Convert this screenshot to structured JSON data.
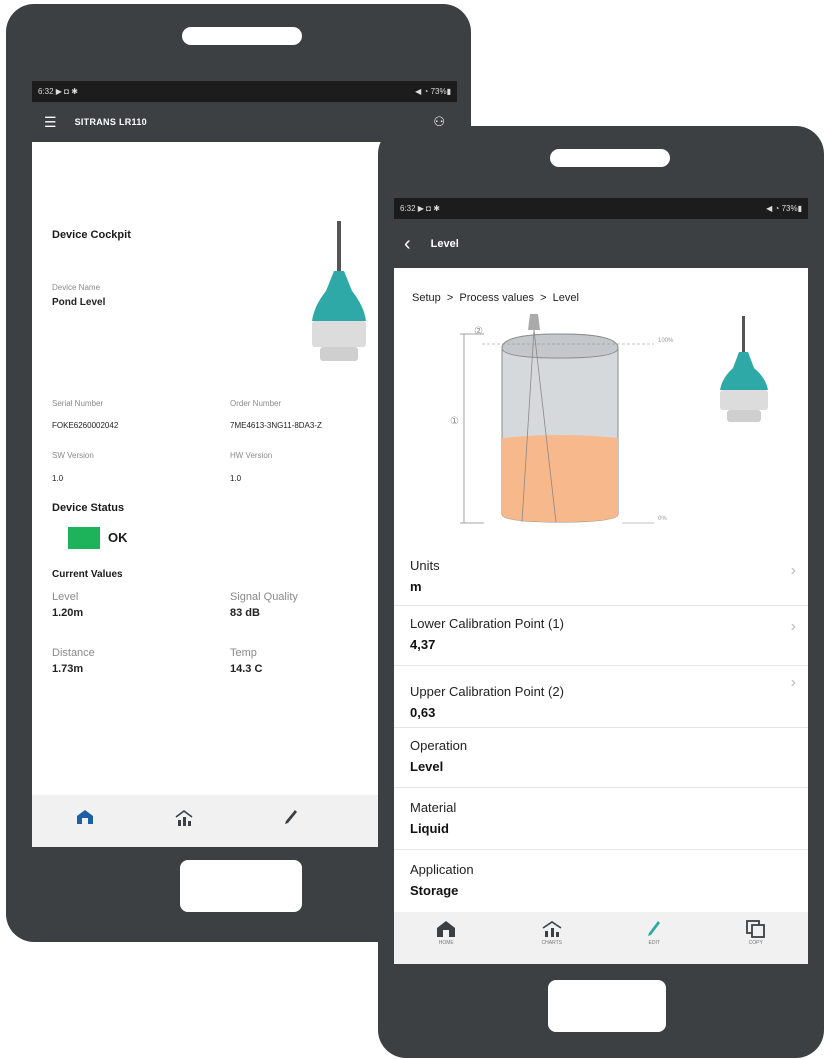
{
  "back_phone": {
    "status_bar": {
      "time": "6:32 ▶ ◘ ✱",
      "right": "◀ ◔ 73%▮"
    },
    "app_bar": {
      "title": "SITRANS LR110"
    },
    "cockpit": {
      "title": "Device Cockpit",
      "device_name_label": "Device Name",
      "device_name": "Pond Level",
      "serial_label": "Serial Number",
      "serial": "FOKE6260002042",
      "order_label": "Order Number",
      "order": "7ME4613-3NG11-8DA3-Z",
      "sw_label": "SW Version",
      "sw": "1.0",
      "hw_label": "HW Version",
      "hw": "1.0",
      "status_title": "Device Status",
      "status_text": "OK",
      "status_color": "#1db35a",
      "current_title": "Current Values",
      "level_label": "Level",
      "level": "1.20m",
      "signal_label": "Signal Quality",
      "signal": "83 dB",
      "distance_label": "Distance",
      "distance": "1.73m",
      "temp_label": "Temp",
      "temp": "14.3 C"
    },
    "nav": {
      "icons": [
        "home-icon",
        "charts-icon",
        "edit-icon"
      ]
    }
  },
  "front_phone": {
    "status_bar": {
      "time": "6:32 ▶ ◘ ✱",
      "right": "◀ ◔ 73%▮"
    },
    "app_bar": {
      "title": "Level"
    },
    "breadcrumb": "Setup  >  Process values  >  Level",
    "diagram": {
      "label_2": "②",
      "label_1": "①",
      "pct_100": "100%",
      "pct_0": "0%"
    },
    "rows": [
      {
        "label": "Units",
        "value": "m",
        "chevron": true
      },
      {
        "label": "Lower Calibration Point (1)",
        "value": "4,37",
        "chevron": true
      },
      {
        "label": "Upper Calibration Point (2)",
        "value": "0,63",
        "chevron": true
      },
      {
        "label": "Operation",
        "value": "Level",
        "chevron": false
      },
      {
        "label": "Material",
        "value": "Liquid",
        "chevron": false
      },
      {
        "label": "Application",
        "value": "Storage",
        "chevron": false
      }
    ],
    "nav": [
      {
        "label": "HOME",
        "icon": "home-icon"
      },
      {
        "label": "CHARTS",
        "icon": "charts-icon"
      },
      {
        "label": "EDIT",
        "icon": "edit-icon"
      },
      {
        "label": "COPY",
        "icon": "copy-icon"
      }
    ]
  },
  "colors": {
    "frame": "#3c4043",
    "accent": "#2fa8a8",
    "tank_fill": "#f7b98c",
    "ok_green": "#1db35a"
  }
}
